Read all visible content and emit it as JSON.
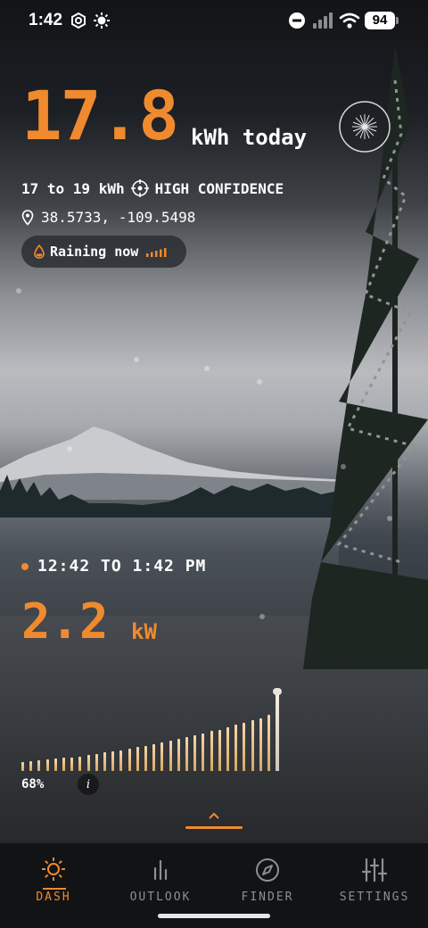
{
  "status_bar": {
    "time": "1:42",
    "battery": "94",
    "icons": [
      "focus-icon",
      "brightness-icon",
      "do-not-disturb-icon",
      "cellular-signal-icon",
      "wifi-icon",
      "battery-icon"
    ]
  },
  "forecast": {
    "today_value": "17.8",
    "today_unit": "kWh today",
    "range": "17 to 19 kWh",
    "confidence": "HIGH CONFIDENCE",
    "coordinates": "38.5733, -109.5498",
    "weather_status": "Raining now"
  },
  "window": {
    "time_range": "12:42 TO 1:42 PM",
    "power_value": "2.2",
    "power_unit": "kW"
  },
  "chart_data": {
    "type": "bar",
    "title": "",
    "values": [
      0.12,
      0.13,
      0.14,
      0.15,
      0.16,
      0.17,
      0.18,
      0.19,
      0.21,
      0.22,
      0.24,
      0.25,
      0.27,
      0.29,
      0.31,
      0.33,
      0.35,
      0.37,
      0.39,
      0.42,
      0.44,
      0.46,
      0.49,
      0.52,
      0.54,
      0.57,
      0.6,
      0.63,
      0.66,
      0.69,
      0.73,
      1.0
    ],
    "percent_label": "68%"
  },
  "tabs": [
    {
      "label": "DASH",
      "icon": "sun-icon",
      "active": true
    },
    {
      "label": "OUTLOOK",
      "icon": "bar-chart-icon",
      "active": false
    },
    {
      "label": "FINDER",
      "icon": "compass-icon",
      "active": false
    },
    {
      "label": "SETTINGS",
      "icon": "sliders-icon",
      "active": false
    }
  ],
  "colors": {
    "accent": "#f08a2e",
    "text": "#ffffff",
    "tab_inactive": "#8d8f93",
    "tabbar_bg": "#121315"
  }
}
